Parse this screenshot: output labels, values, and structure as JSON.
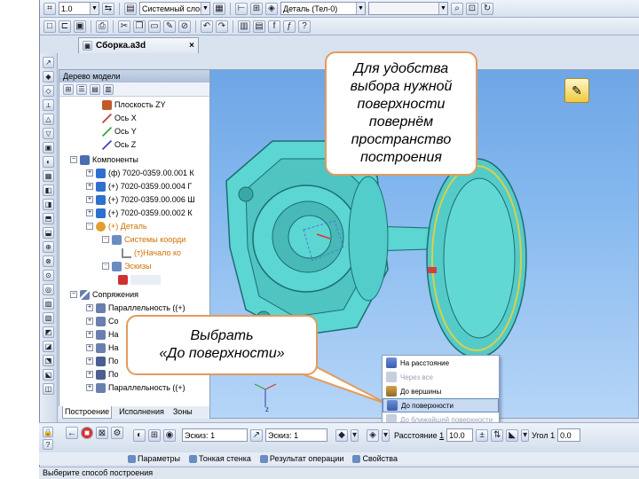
{
  "toolbar1": {
    "scale_value": "1.0",
    "layer_value": "Системный слой (0)",
    "part_value": "Деталь (Тел-0)",
    "empty_combo": ""
  },
  "document_tab": {
    "title": "Сборка.a3d"
  },
  "tree": {
    "title": "Дерево модели",
    "pin": "ᵽ x",
    "items": [
      {
        "label": "Плоскость ZY",
        "style": "normal"
      },
      {
        "label": "Ось X",
        "style": "normal"
      },
      {
        "label": "Ось Y",
        "style": "normal"
      },
      {
        "label": "Ось Z",
        "style": "normal"
      },
      {
        "label": "Компоненты",
        "style": "normal"
      },
      {
        "label": "(ф) 7020-0359.00.001 К",
        "style": "normal"
      },
      {
        "label": "(+) 7020-0359.00.004 Г",
        "style": "normal"
      },
      {
        "label": "(+) 7020-0359.00.006 Ш",
        "style": "normal"
      },
      {
        "label": "(+) 7020-0359.00.002 К",
        "style": "normal"
      },
      {
        "label": "(+) Деталь",
        "style": "orange"
      },
      {
        "label": "Системы коорди",
        "style": "orange"
      },
      {
        "label": "(т)Начало ко",
        "style": "orange"
      },
      {
        "label": "Эскизы",
        "style": "orange"
      },
      {
        "label": "Сопряжения",
        "style": "normal"
      },
      {
        "label": "Параллельность ((+)",
        "style": "normal"
      },
      {
        "label": "Со",
        "style": "normal"
      },
      {
        "label": "На",
        "style": "normal"
      },
      {
        "label": "На",
        "style": "normal"
      },
      {
        "label": "По",
        "style": "normal"
      },
      {
        "label": "По",
        "style": "normal"
      },
      {
        "label": "Параллельность ((+)",
        "style": "normal"
      }
    ],
    "tabs": [
      "Построение",
      "Исполнения",
      "Зоны"
    ]
  },
  "callouts": {
    "top": "Для удобства выбора нужной поверхности повернём пространство построения",
    "bottom_line1": "Выбрать",
    "bottom_line2": "«До поверхности»"
  },
  "menu": {
    "items": [
      {
        "label": "На расстояние",
        "state": "normal"
      },
      {
        "label": "Через все",
        "state": "disabled"
      },
      {
        "label": "До вершины",
        "state": "normal"
      },
      {
        "label": "До поверхности",
        "state": "selected"
      },
      {
        "label": "До ближайшей поверхности",
        "state": "disabled"
      }
    ]
  },
  "props": {
    "sketch_label": "Эскиз:",
    "sketch_value": "1",
    "sketch2_label": "Эскиз:",
    "sketch2_value": "1",
    "distance_label": "Расстояние",
    "distance_index": "1",
    "distance_value": "10.0",
    "angle_label": "Угол",
    "angle_index": "1",
    "angle_value": "0.0",
    "tabs": [
      "Параметры",
      "Тонкая стенка",
      "Результат операции",
      "Свойства"
    ]
  },
  "status": {
    "text": "Выберите способ построения"
  },
  "axis_label": "z",
  "colors": {
    "model": "#5bd6d2",
    "callout_border": "#e39b5b",
    "accent": "#c8daf2"
  }
}
